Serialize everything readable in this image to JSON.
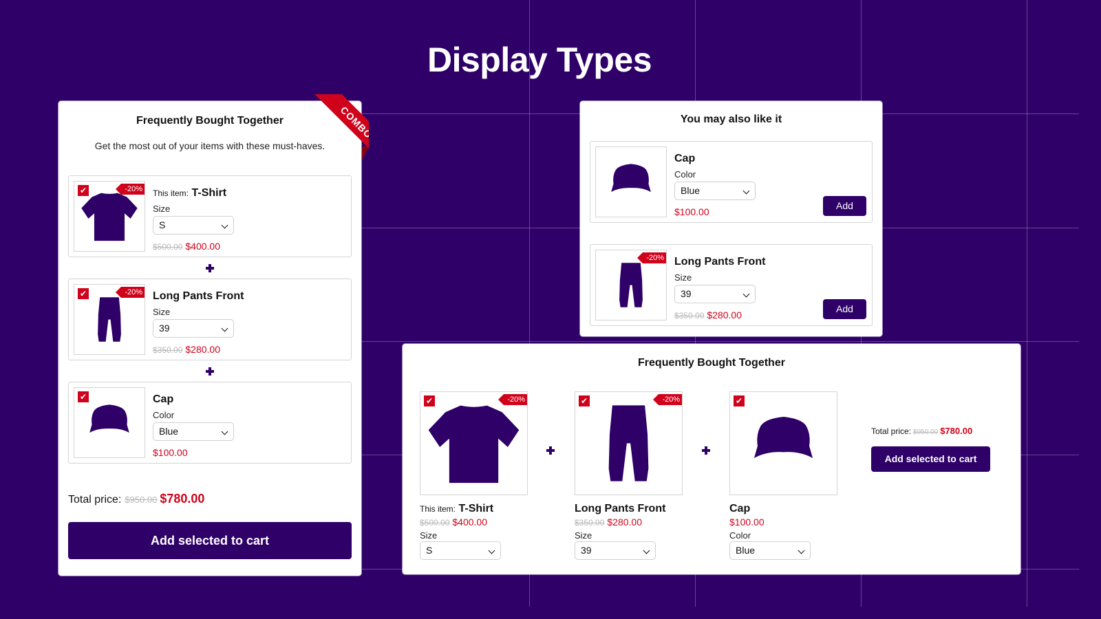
{
  "page": {
    "title": "Display Types"
  },
  "colors": {
    "brand": "#2e0068",
    "accent_red": "#d0021b",
    "strike_gray": "#b7b7b7"
  },
  "fbt_list": {
    "title": "Frequently Bought Together",
    "subtitle": "Get the most out of your items with these must-haves.",
    "ribbon": "COMBO",
    "items": [
      {
        "prefix": "This item:",
        "name": "T-Shirt",
        "icon": "tshirt-icon",
        "checked": true,
        "badge": "-20%",
        "option_label": "Size",
        "option_value": "S",
        "old_price": "$500.00",
        "price": "$400.00"
      },
      {
        "prefix": "",
        "name": "Long Pants Front",
        "icon": "pants-icon",
        "checked": true,
        "badge": "-20%",
        "option_label": "Size",
        "option_value": "39",
        "old_price": "$350.00",
        "price": "$280.00"
      },
      {
        "prefix": "",
        "name": "Cap",
        "icon": "cap-icon",
        "checked": true,
        "badge": "",
        "option_label": "Color",
        "option_value": "Blue",
        "old_price": "",
        "price": "$100.00"
      }
    ],
    "total_label": "Total price:",
    "total_old": "$950.00",
    "total_new": "$780.00",
    "button": "Add selected to cart"
  },
  "you_may_like": {
    "title": "You may also like it",
    "items": [
      {
        "name": "Cap",
        "icon": "cap-icon",
        "badge": "",
        "option_label": "Color",
        "option_value": "Blue",
        "old_price": "",
        "price": "$100.00",
        "button": "Add"
      },
      {
        "name": "Long Pants Front",
        "icon": "pants-icon",
        "badge": "-20%",
        "option_label": "Size",
        "option_value": "39",
        "old_price": "$350.00",
        "price": "$280.00",
        "button": "Add"
      }
    ]
  },
  "fbt_grid": {
    "title": "Frequently Bought Together",
    "items": [
      {
        "prefix": "This item:",
        "name": "T-Shirt",
        "icon": "tshirt-icon",
        "checked": true,
        "badge": "-20%",
        "option_label": "Size",
        "option_value": "S",
        "old_price": "$500.00",
        "price": "$400.00"
      },
      {
        "prefix": "",
        "name": "Long Pants Front",
        "icon": "pants-icon",
        "checked": true,
        "badge": "-20%",
        "option_label": "Size",
        "option_value": "39",
        "old_price": "$350.00",
        "price": "$280.00"
      },
      {
        "prefix": "",
        "name": "Cap",
        "icon": "cap-icon",
        "checked": true,
        "badge": "",
        "option_label": "Color",
        "option_value": "Blue",
        "old_price": "",
        "price": "$100.00"
      }
    ],
    "total_label": "Total price:",
    "total_old": "$950.00",
    "total_new": "$780.00",
    "button": "Add selected to cart"
  },
  "glyphs": {
    "check": "✔"
  }
}
